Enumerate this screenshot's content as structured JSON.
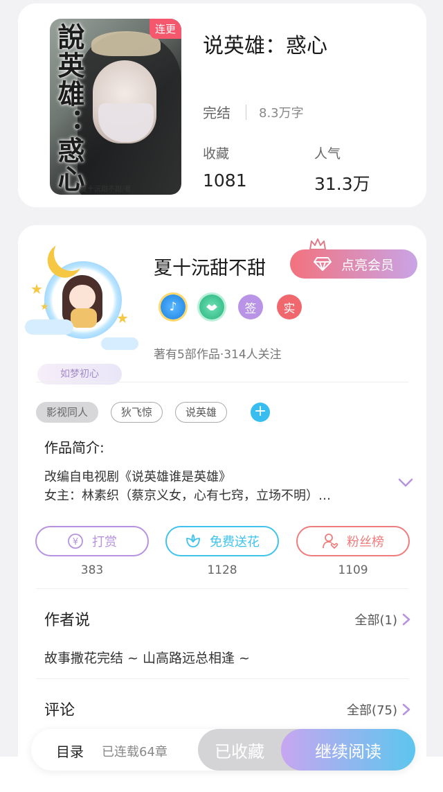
{
  "book": {
    "cover_title": "說英雄：惑心",
    "cover_author": "夏十沅甜不甜/著",
    "cover_badge": "连更",
    "title": "说英雄：惑心",
    "status": "完结",
    "word_count": "8.3万字",
    "collect_label": "收藏",
    "collect_value": "1081",
    "popularity_label": "人气",
    "popularity_value": "31.3万"
  },
  "author": {
    "name": "夏十沅甜不甜",
    "vip_button": "点亮会员",
    "badges": [
      "♪",
      "签",
      "实"
    ],
    "avatar_frame_label": "如梦初心",
    "meta": "著有5部作品·314人关注"
  },
  "tags": [
    "影视同人",
    "狄飞惊",
    "说英雄"
  ],
  "tag_add": "+",
  "intro": {
    "label": "作品简介:",
    "line1": "改编自电视剧《说英雄谁是英雄》",
    "line2": "女主：林素织（蔡京义女，心有七窍，立场不明）…"
  },
  "actions": [
    {
      "label": "打赏",
      "count": "383",
      "color": "#b692e0"
    },
    {
      "label": "免费送花",
      "count": "1128",
      "color": "#3fc3ec"
    },
    {
      "label": "粉丝榜",
      "count": "1109",
      "color": "#ef7c7c"
    }
  ],
  "author_say": {
    "title": "作者说",
    "more": "全部(1)",
    "content": "故事撒花完结 ~ 山高路远总相逢 ~"
  },
  "comments": {
    "title": "评论",
    "more": "全部(75)"
  },
  "bottom_bar": {
    "toc": "目录",
    "serial": "已连载64章",
    "collected": "已收藏",
    "read": "继续阅读"
  }
}
